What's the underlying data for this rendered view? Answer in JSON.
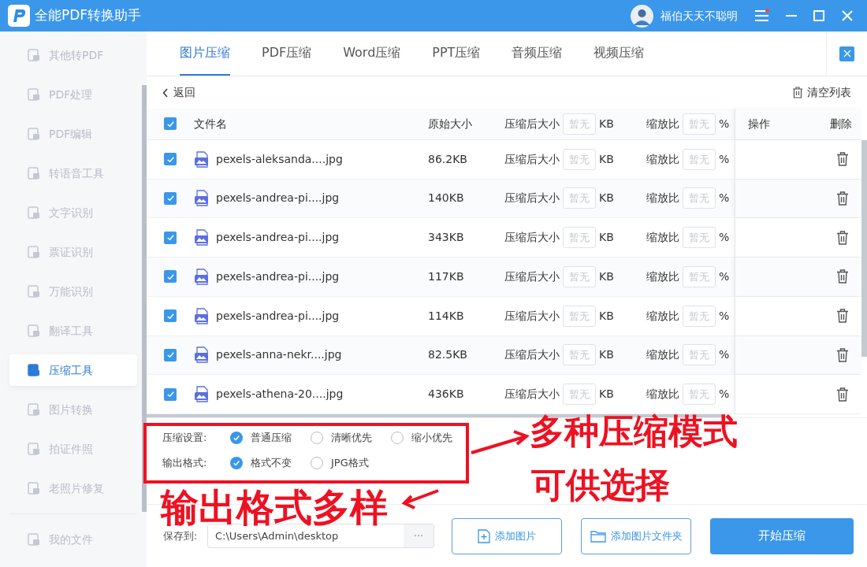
{
  "window": {
    "title": "全能PDF转换助手",
    "user": "福伯天天不聪明",
    "menu_badge": true
  },
  "sidebar": {
    "items": [
      {
        "label": "其他转PDF",
        "selected": false
      },
      {
        "label": "PDF处理",
        "selected": false
      },
      {
        "label": "PDF编辑",
        "selected": false
      },
      {
        "label": "转语音工具",
        "selected": false
      },
      {
        "label": "文字识别",
        "selected": false
      },
      {
        "label": "票证识别",
        "selected": false
      },
      {
        "label": "万能识别",
        "selected": false
      },
      {
        "label": "翻译工具",
        "selected": false
      },
      {
        "label": "压缩工具",
        "selected": true
      },
      {
        "label": "图片转换",
        "selected": false
      },
      {
        "label": "拍证件照",
        "selected": false
      },
      {
        "label": "老照片修复",
        "selected": false
      }
    ],
    "footer": "我的文件"
  },
  "tabs": [
    {
      "label": "图片压缩",
      "selected": true
    },
    {
      "label": "PDF压缩",
      "selected": false
    },
    {
      "label": "Word压缩",
      "selected": false
    },
    {
      "label": "PPT压缩",
      "selected": false
    },
    {
      "label": "音频压缩",
      "selected": false
    },
    {
      "label": "视频压缩",
      "selected": false
    }
  ],
  "back": "返回",
  "clear_list": "清空列表",
  "table": {
    "header": {
      "checked": true,
      "filename": "文件名",
      "original_size": "原始大小",
      "compressed_label": "压缩后大小",
      "compressed_placeholder": "暂无",
      "compressed_unit": "KB",
      "ratio_label": "缩放比",
      "ratio_placeholder": "暂无",
      "ratio_unit": "%",
      "actions": "操作",
      "delete": "删除"
    },
    "rows": [
      {
        "checked": true,
        "filename": "pexels-aleksanda....jpg",
        "size": "86.2KB",
        "compressed_label": "压缩后大小",
        "compressed_placeholder": "暂无",
        "compressed_unit": "KB",
        "ratio_label": "缩放比",
        "ratio_placeholder": "暂无",
        "ratio_unit": "%"
      },
      {
        "checked": true,
        "filename": "pexels-andrea-pi....jpg",
        "size": "140KB",
        "compressed_label": "压缩后大小",
        "compressed_placeholder": "暂无",
        "compressed_unit": "KB",
        "ratio_label": "缩放比",
        "ratio_placeholder": "暂无",
        "ratio_unit": "%"
      },
      {
        "checked": true,
        "filename": "pexels-andrea-pi....jpg",
        "size": "343KB",
        "compressed_label": "压缩后大小",
        "compressed_placeholder": "暂无",
        "compressed_unit": "KB",
        "ratio_label": "缩放比",
        "ratio_placeholder": "暂无",
        "ratio_unit": "%"
      },
      {
        "checked": true,
        "filename": "pexels-andrea-pi....jpg",
        "size": "117KB",
        "compressed_label": "压缩后大小",
        "compressed_placeholder": "暂无",
        "compressed_unit": "KB",
        "ratio_label": "缩放比",
        "ratio_placeholder": "暂无",
        "ratio_unit": "%"
      },
      {
        "checked": true,
        "filename": "pexels-andrea-pi....jpg",
        "size": "114KB",
        "compressed_label": "压缩后大小",
        "compressed_placeholder": "暂无",
        "compressed_unit": "KB",
        "ratio_label": "缩放比",
        "ratio_placeholder": "暂无",
        "ratio_unit": "%"
      },
      {
        "checked": true,
        "filename": "pexels-anna-nekr....jpg",
        "size": "82.5KB",
        "compressed_label": "压缩后大小",
        "compressed_placeholder": "暂无",
        "compressed_unit": "KB",
        "ratio_label": "缩放比",
        "ratio_placeholder": "暂无",
        "ratio_unit": "%"
      },
      {
        "checked": true,
        "filename": "pexels-athena-20....jpg",
        "size": "436KB",
        "compressed_label": "压缩后大小",
        "compressed_placeholder": "暂无",
        "compressed_unit": "KB",
        "ratio_label": "缩放比",
        "ratio_placeholder": "暂无",
        "ratio_unit": "%"
      }
    ]
  },
  "settings": [
    {
      "label": "压缩设置:",
      "options": [
        {
          "label": "普通压缩",
          "selected": true
        },
        {
          "label": "清晰优先",
          "selected": false
        },
        {
          "label": "缩小优先",
          "selected": false
        }
      ]
    },
    {
      "label": "输出格式:",
      "options": [
        {
          "label": "格式不变",
          "selected": true
        },
        {
          "label": "JPG格式",
          "selected": false
        }
      ]
    }
  ],
  "save": {
    "label": "保存到:",
    "value": "C:\\Users\\Admin\\desktop",
    "browse": "···"
  },
  "buttons": [
    {
      "kind": "add_file",
      "label": "添加图片"
    },
    {
      "kind": "add_folder",
      "label": "添加图片文件夹"
    },
    {
      "kind": "primary",
      "label": "开始压缩"
    }
  ],
  "annotations": {
    "modes_line1": "多种压缩模式",
    "modes_line2": "可供选择",
    "formats": "输出格式多样"
  }
}
